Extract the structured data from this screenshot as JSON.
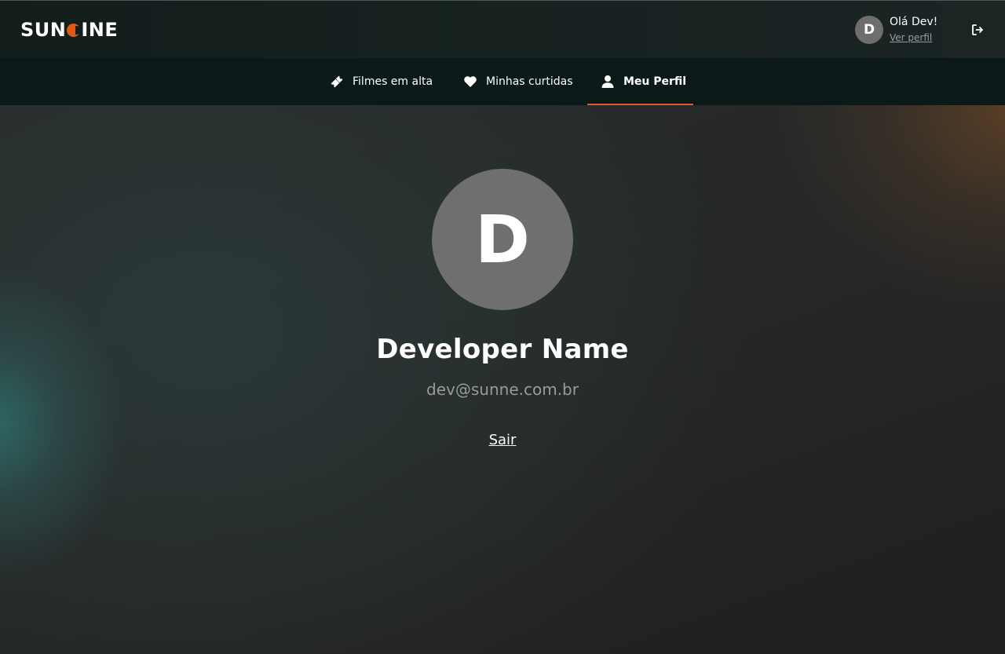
{
  "header": {
    "logo_text": "SUNCINE",
    "logo_part1": "SUN",
    "logo_part2": "INE",
    "accent_color": "#e05a14",
    "user": {
      "avatar_initial": "D",
      "greeting": "Olá Dev!",
      "view_profile_label": "Ver perfil"
    },
    "logout_icon": "logout-icon"
  },
  "nav": {
    "items": [
      {
        "label": "Filmes em alta",
        "icon": "ticket-icon",
        "active": false
      },
      {
        "label": "Minhas curtidas",
        "icon": "heart-icon",
        "active": false
      },
      {
        "label": "Meu Perfil",
        "icon": "user-icon",
        "active": true
      }
    ],
    "active_underline_color": "#e05a2a"
  },
  "profile": {
    "avatar_initial": "D",
    "name": "Developer Name",
    "email": "dev@sunne.com.br",
    "signout_label": "Sair"
  }
}
